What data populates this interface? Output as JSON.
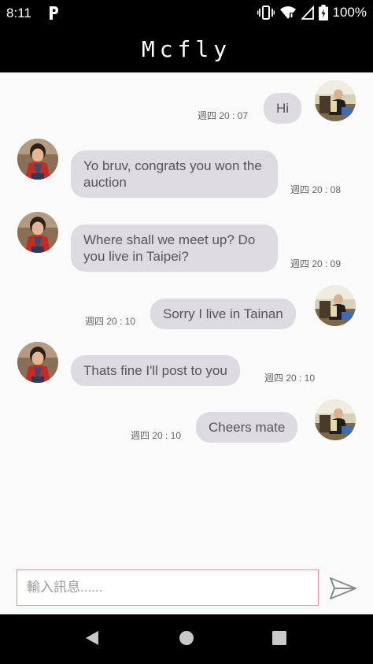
{
  "status_bar": {
    "time": "8:11",
    "battery": "100%"
  },
  "header": {
    "title": "Mcfly"
  },
  "messages": [
    {
      "text": "Hi",
      "time": "週四 20 : 07",
      "sender": "me"
    },
    {
      "text": "Yo bruv, congrats you won the auction",
      "time": "週四 20 : 08",
      "sender": "other"
    },
    {
      "text": "Where shall we meet up? Do you live in Taipei?",
      "time": "週四 20 : 09",
      "sender": "other"
    },
    {
      "text": "Sorry I live in Tainan",
      "time": "週四 20 : 10",
      "sender": "me"
    },
    {
      "text": "Thats fine I'll post to you",
      "time": "週四 20 : 10",
      "sender": "other"
    },
    {
      "text": "Cheers mate",
      "time": "週四 20 : 10",
      "sender": "me"
    }
  ],
  "composer": {
    "placeholder": "輸入訊息......",
    "value": ""
  },
  "colors": {
    "bar": "#000000",
    "bubble": "#dddae1",
    "input_border": "#e88b95"
  },
  "icons": [
    "parking-icon",
    "vibrate-icon",
    "wifi-icon",
    "signal-icon",
    "battery-icon",
    "send-icon",
    "back-icon",
    "home-icon",
    "recents-icon"
  ]
}
